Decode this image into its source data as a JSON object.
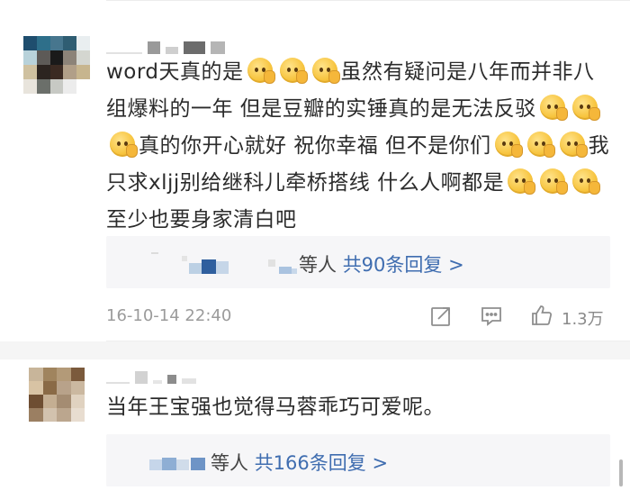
{
  "comments": [
    {
      "text_segments": [
        {
          "type": "text",
          "value": "word天真的是"
        },
        {
          "type": "emoji"
        },
        {
          "type": "emoji"
        },
        {
          "type": "emoji"
        },
        {
          "type": "text",
          "value": "虽然有疑问是八年而并非八组爆料的一年 但是豆瓣的实锤真的是无法反驳"
        },
        {
          "type": "emoji"
        },
        {
          "type": "emoji"
        },
        {
          "type": "emoji"
        },
        {
          "type": "text",
          "value": "真的你开心就好 祝你幸福 但不是你们"
        },
        {
          "type": "emoji"
        },
        {
          "type": "emoji"
        },
        {
          "type": "emoji"
        },
        {
          "type": "text",
          "value": "我只求xljj别给继科儿牵桥搭线 什么人啊都是"
        },
        {
          "type": "emoji"
        },
        {
          "type": "emoji"
        },
        {
          "type": "emoji"
        },
        {
          "type": "text",
          "value": "至少也要身家清白吧"
        }
      ],
      "replies": {
        "suffix": "等人",
        "link": "共90条回复 >"
      },
      "timestamp": "16-10-14 22:40",
      "like_count": "1.3万"
    },
    {
      "text": "当年王宝强也觉得马蓉乖巧可爱呢。",
      "replies": {
        "suffix": "等人",
        "link": "共166条回复 >"
      }
    }
  ],
  "icons": [
    "share-icon",
    "comment-icon",
    "like-icon",
    "emoji-icon"
  ],
  "colors": {
    "link": "#3f6db0",
    "meta": "#9b9b9b",
    "reply_bg": "#f6f6f8"
  }
}
